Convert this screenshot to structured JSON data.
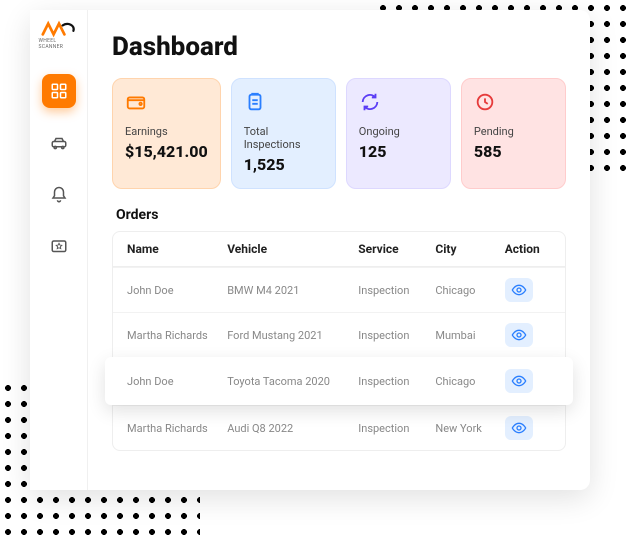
{
  "logo_text": "WHEEL SCANNER",
  "page_title": "Dashboard",
  "cards": {
    "earnings": {
      "label": "Earnings",
      "value": "$15,421.00"
    },
    "inspections": {
      "label": "Total Inspections",
      "value": "1,525"
    },
    "ongoing": {
      "label": "Ongoing",
      "value": "125"
    },
    "pending": {
      "label": "Pending",
      "value": "585"
    }
  },
  "orders_title": "Orders",
  "columns": {
    "name": "Name",
    "vehicle": "Vehicle",
    "service": "Service",
    "city": "City",
    "action": "Action"
  },
  "rows": [
    {
      "name": "John Doe",
      "vehicle": "BMW M4  2021",
      "service": "Inspection",
      "city": "Chicago"
    },
    {
      "name": "Martha Richards",
      "vehicle": "Ford Mustang 2021",
      "service": "Inspection",
      "city": "Mumbai"
    },
    {
      "name": "John Doe",
      "vehicle": "Toyota Tacoma 2020",
      "service": "Inspection",
      "city": "Chicago"
    },
    {
      "name": "Martha Richards",
      "vehicle": "Audi Q8 2022",
      "service": "Inspection",
      "city": "New York"
    }
  ]
}
